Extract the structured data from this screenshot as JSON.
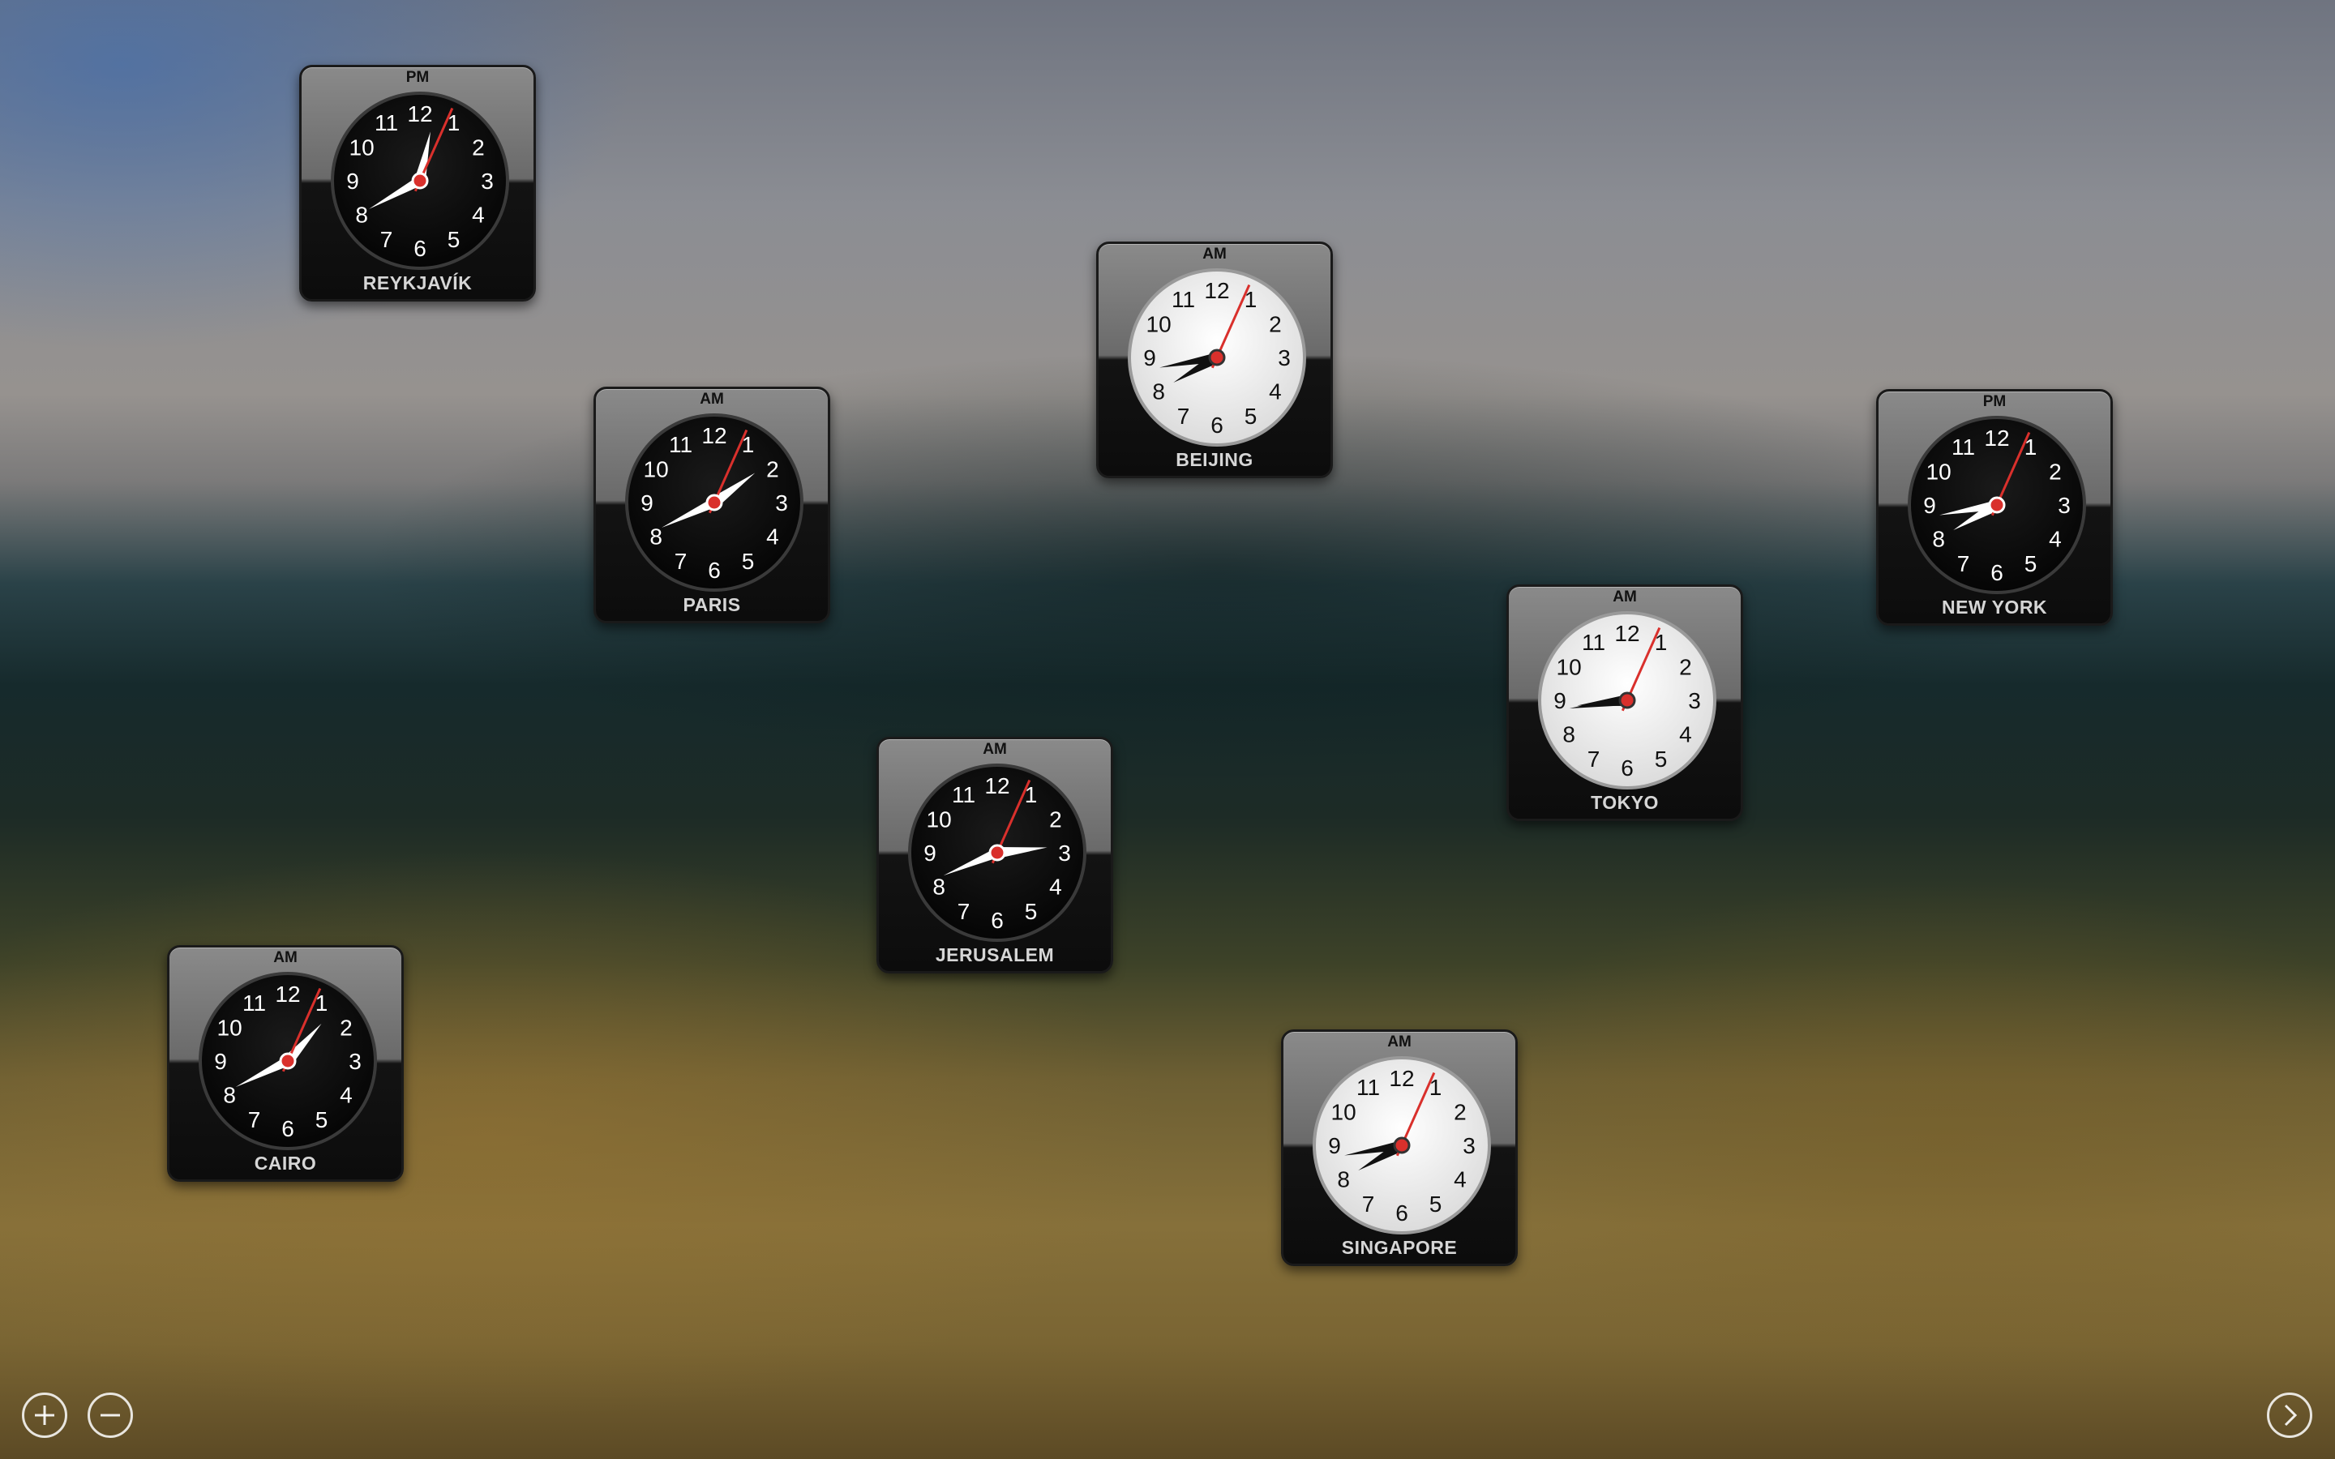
{
  "clocks": [
    {
      "city": "REYKJAVÍK",
      "period": "PM",
      "theme": "dark",
      "hour": 8,
      "minute": 2,
      "second": 4
    },
    {
      "city": "PARIS",
      "period": "AM",
      "theme": "dark",
      "hour": 8,
      "minute": 9,
      "second": 4
    },
    {
      "city": "BEIJING",
      "period": "AM",
      "theme": "light",
      "hour": 8,
      "minute": 40,
      "second": 4
    },
    {
      "city": "NEW YORK",
      "period": "PM",
      "theme": "dark",
      "hour": 8,
      "minute": 40,
      "second": 4
    },
    {
      "city": "TOKYO",
      "period": "AM",
      "theme": "light",
      "hour": 8,
      "minute": 44,
      "second": 4
    },
    {
      "city": "JERUSALEM",
      "period": "AM",
      "theme": "dark",
      "hour": 8,
      "minute": 14,
      "second": 4
    },
    {
      "city": "CAIRO",
      "period": "AM",
      "theme": "dark",
      "hour": 8,
      "minute": 7,
      "second": 4
    },
    {
      "city": "SINGAPORE",
      "period": "AM",
      "theme": "light",
      "hour": 8,
      "minute": 40,
      "second": 4
    }
  ],
  "dial_numbers": [
    "12",
    "1",
    "2",
    "3",
    "4",
    "5",
    "6",
    "7",
    "8",
    "9",
    "10",
    "11"
  ],
  "controls": {
    "add": "plus-icon",
    "remove": "minus-icon",
    "next": "chevron-right-icon"
  },
  "colors": {
    "second_hand": "#d9302c",
    "dark_face": "#050505",
    "light_face": "#f2f2f2"
  }
}
